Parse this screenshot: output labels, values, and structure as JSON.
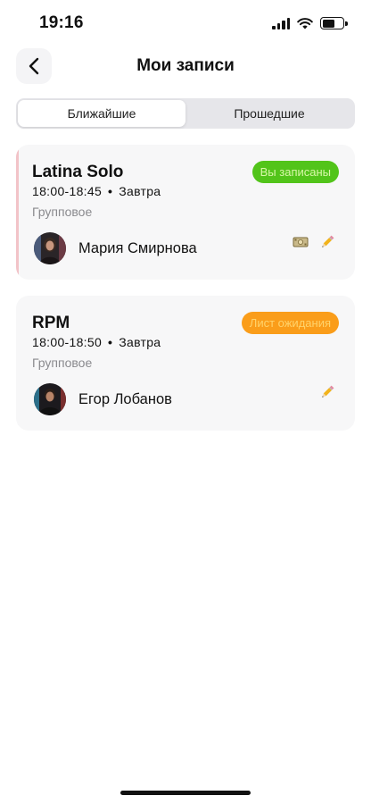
{
  "status_bar": {
    "time": "19:16"
  },
  "header": {
    "title": "Мои записи"
  },
  "tabs": [
    {
      "label": "Ближайшие",
      "active": true
    },
    {
      "label": "Прошедшие",
      "active": false
    }
  ],
  "bookings": [
    {
      "title": "Latina Solo",
      "time": "18:00-18:45",
      "day": "Завтра",
      "type": "Групповое",
      "status": "Вы записаны",
      "status_color": "#52c41a",
      "trainer": "Мария Смирнова",
      "actions": [
        "money-icon",
        "pencil-icon"
      ]
    },
    {
      "title": "RPM",
      "time": "18:00-18:50",
      "day": "Завтра",
      "type": "Групповое",
      "status": "Лист ожидания",
      "status_color": "#fa9d1a",
      "trainer": "Егор Лобанов",
      "actions": [
        "pencil-icon"
      ]
    }
  ]
}
